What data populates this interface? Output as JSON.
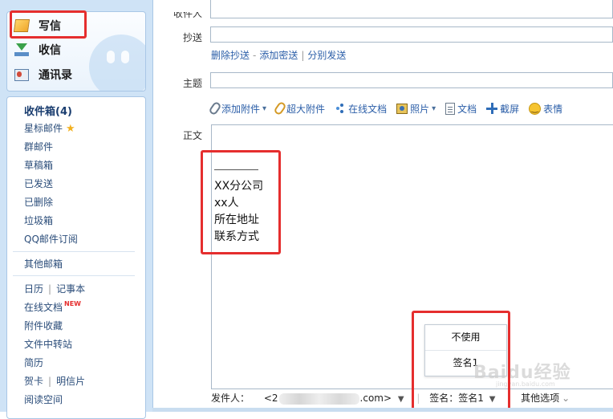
{
  "sidebar": {
    "top_actions": {
      "write": "写信",
      "receive": "收信",
      "contacts": "通讯录"
    },
    "folders": {
      "inbox": "收件箱(4)",
      "starred": "星标邮件",
      "group": "群邮件",
      "drafts": "草稿箱",
      "sent": "已发送",
      "deleted": "已删除",
      "spam": "垃圾箱",
      "subscriptions": "QQ邮件订阅"
    },
    "other_mailboxes": "其他邮箱",
    "apps": {
      "calendar": "日历",
      "notes": "记事本",
      "online_docs": "在线文档",
      "new_badge": "NEW",
      "attachments": "附件收藏",
      "file_transfer": "文件中转站",
      "resume": "简历",
      "greeting_cards": "贺卡",
      "postcards": "明信片",
      "reading_space": "阅读空间"
    }
  },
  "compose": {
    "to_label": "收件人",
    "cc_label": "抄送",
    "cc_links": [
      "删除抄送",
      "添加密送",
      "分别发送"
    ],
    "subject_label": "主题",
    "body_label": "正文",
    "toolbar": {
      "add_attachment": "添加附件",
      "large_attachment": "超大附件",
      "online_doc": "在线文档",
      "photo": "照片",
      "document": "文档",
      "screenshot": "截屏",
      "emoji": "表情"
    },
    "signature_preview": {
      "rule": "________",
      "lines": [
        "XX分公司",
        "xx人",
        "所在地址",
        "联系方式"
      ]
    },
    "signature_menu": {
      "option_none": "不使用",
      "option_sig1": "签名1"
    },
    "footer": {
      "sender_label": "发件人：",
      "sender_prefix": "<2",
      "sender_suffix": ".com>",
      "signature_label": "签名：签名1",
      "more_options": "其他选项"
    }
  },
  "watermark": {
    "text": "Baidu经验",
    "sub": "jingyan.baidu.com"
  },
  "colors": {
    "highlight_box": "#e52e2e",
    "link": "#2b5ea8",
    "sidebar_bg": "#cfe3f6"
  }
}
